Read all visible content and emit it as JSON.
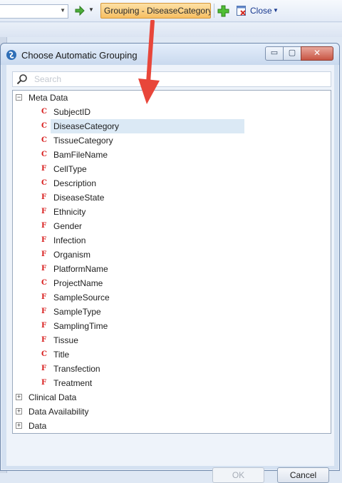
{
  "toolbar": {
    "combo_value": "",
    "grouping_label": "Grouping - DiseaseCategory",
    "close_label": "Close"
  },
  "dialog": {
    "title": "Choose Automatic Grouping",
    "search_placeholder": "Search",
    "minimize_glyph": "▭",
    "maximize_glyph": "▢",
    "close_glyph": "✕",
    "ok_label": "OK",
    "cancel_label": "Cancel"
  },
  "tree": {
    "groups": [
      {
        "label": "Meta Data",
        "expanded": true,
        "expander_glyph": "−",
        "items": [
          {
            "icon": "C",
            "label": "SubjectID"
          },
          {
            "icon": "C",
            "label": "DiseaseCategory",
            "selected": true
          },
          {
            "icon": "C",
            "label": "TissueCategory"
          },
          {
            "icon": "C",
            "label": "BamFileName"
          },
          {
            "icon": "F",
            "label": "CellType"
          },
          {
            "icon": "C",
            "label": "Description"
          },
          {
            "icon": "F",
            "label": "DiseaseState"
          },
          {
            "icon": "F",
            "label": "Ethnicity"
          },
          {
            "icon": "F",
            "label": "Gender"
          },
          {
            "icon": "F",
            "label": "Infection"
          },
          {
            "icon": "F",
            "label": "Organism"
          },
          {
            "icon": "F",
            "label": "PlatformName"
          },
          {
            "icon": "C",
            "label": "ProjectName"
          },
          {
            "icon": "F",
            "label": "SampleSource"
          },
          {
            "icon": "F",
            "label": "SampleType"
          },
          {
            "icon": "F",
            "label": "SamplingTime"
          },
          {
            "icon": "F",
            "label": "Tissue"
          },
          {
            "icon": "C",
            "label": "Title"
          },
          {
            "icon": "F",
            "label": "Transfection"
          },
          {
            "icon": "F",
            "label": "Treatment"
          }
        ]
      },
      {
        "label": "Clinical Data",
        "expanded": false,
        "expander_glyph": "+"
      },
      {
        "label": "Data Availability",
        "expanded": false,
        "expander_glyph": "+"
      },
      {
        "label": "Data",
        "expanded": false,
        "expander_glyph": "+"
      }
    ]
  },
  "colors": {
    "grouping_highlight": "#f7bf62",
    "selection": "#dbe9f5",
    "annotation_arrow": "#e8463a",
    "leaf_icon": "#d81e1e"
  }
}
